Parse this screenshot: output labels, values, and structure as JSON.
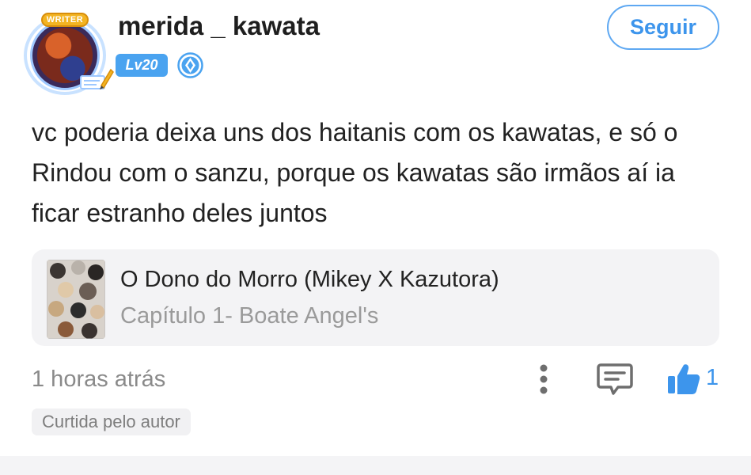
{
  "author": {
    "username": "merida _ kawata",
    "writer_badge": "WRITER",
    "level": "Lv20",
    "follow_label": "Seguir"
  },
  "comment": {
    "text": "vc poderia deixa uns dos haitanis com os kawatas, e só o Rindou com o sanzu, porque os kawatas são irmãos aí ia ficar estranho deles juntos"
  },
  "story": {
    "title": "O Dono do Morro (Mikey X Kazutora)",
    "chapter": "Capítulo 1- Boate Angel's"
  },
  "footer": {
    "timestamp": "1 horas atrás",
    "like_count": "1",
    "liked_by_author": "Curtida pelo autor"
  },
  "icons": {
    "more": "more-vertical-icon",
    "comment": "comment-icon",
    "like": "thumbs-up-icon",
    "verified": "verified-icon",
    "pen": "pen-icon"
  },
  "colors": {
    "accent": "#3d95ec",
    "level_badge": "#4aa3f0",
    "muted_text": "#8a8a8a",
    "card_bg": "#f3f3f5"
  }
}
